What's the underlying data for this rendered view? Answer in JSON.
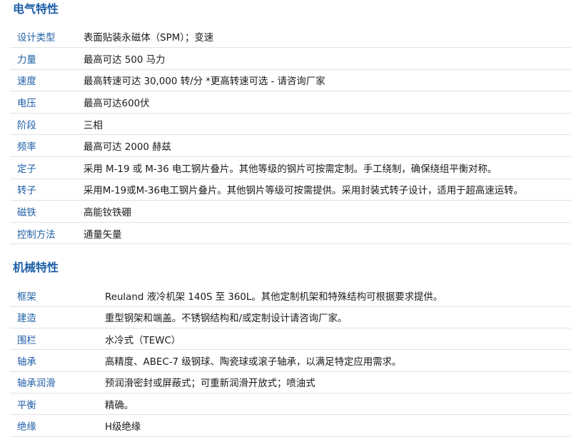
{
  "electrical": {
    "title": "电气特性",
    "rows": [
      {
        "label": "设计类型",
        "value": "表面贴装永磁体（SPM）；变速"
      },
      {
        "label": "力量",
        "value": "最高可达 500 马力"
      },
      {
        "label": "速度",
        "value": "最高转速可达 30,000 转/分 *更高转速可选 - 请咨询厂家"
      },
      {
        "label": "电压",
        "value": "最高可达600伏"
      },
      {
        "label": "阶段",
        "value": "三相"
      },
      {
        "label": "频率",
        "value": "最高可达 2000 赫兹"
      },
      {
        "label": "定子",
        "value": "采用 M-19 或 M-36 电工钢片叠片。其他等级的钢片可按需定制。手工绕制，确保绕组平衡对称。"
      },
      {
        "label": "转子",
        "value": "采用M-19或M-36电工钢片叠片。其他钢片等级可按需提供。采用封装式转子设计，适用于超高速运转。"
      },
      {
        "label": "磁铁",
        "value": "高能钕铁硼"
      },
      {
        "label": "控制方法",
        "value": "通量矢量"
      }
    ]
  },
  "mechanical": {
    "title": "机械特性",
    "rows": [
      {
        "label": "框架",
        "value": "Reuland 液冷机架 140S 至 360L。其他定制机架和特殊结构可根据要求提供。"
      },
      {
        "label": "建造",
        "value": "重型钢架和端盖。不锈钢结构和/或定制设计请咨询厂家。"
      },
      {
        "label": "围栏",
        "value": "水冷式（TEWC）"
      },
      {
        "label": "轴承",
        "value": "高精度、ABEC-7 级钢球、陶瓷球或滚子轴承，以满足特定应用需求。"
      },
      {
        "label": "轴承润滑",
        "value": "预润滑密封或屏蔽式；可重新润滑开放式；喷油式"
      },
      {
        "label": "平衡",
        "value": "精确。"
      },
      {
        "label": "绝缘",
        "value": "H级绝缘"
      }
    ]
  }
}
